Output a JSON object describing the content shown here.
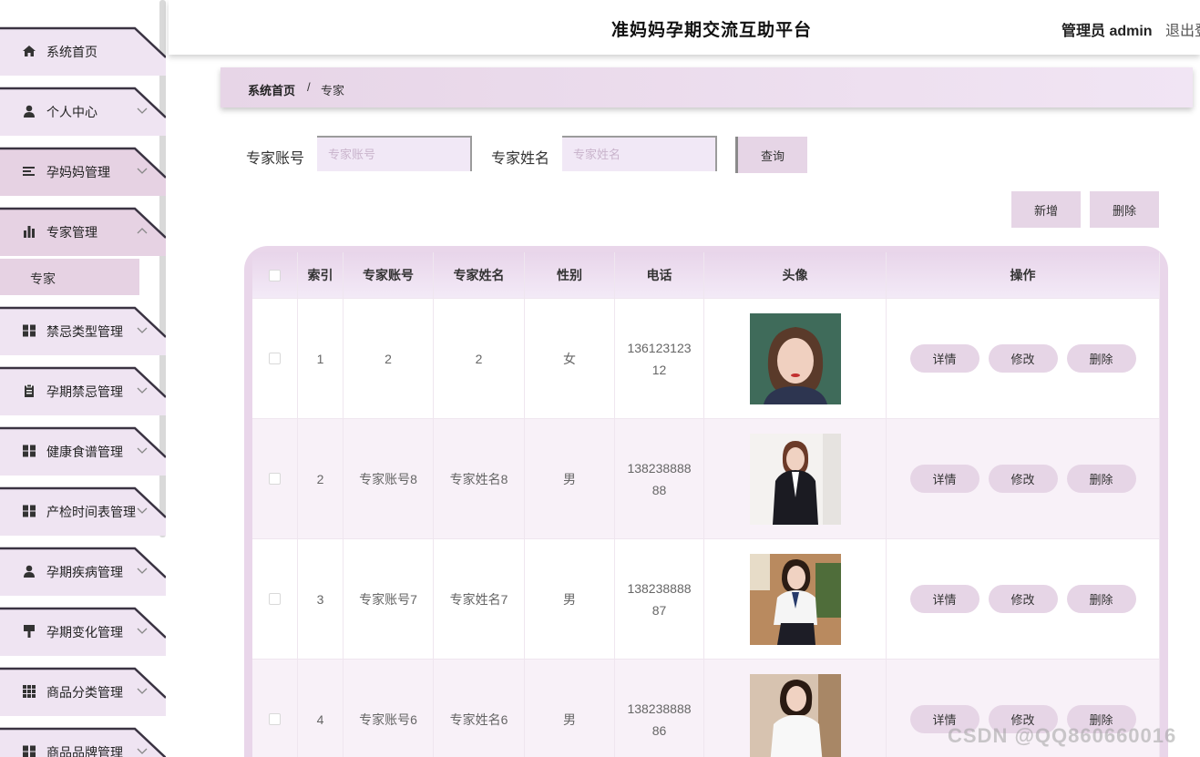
{
  "header": {
    "title": "准妈妈孕期交流互助平台",
    "admin": "管理员 admin",
    "logout": "退出登"
  },
  "sidebar": {
    "items": [
      {
        "label": "系统首页",
        "icon": "home-icon",
        "has_chevron": false
      },
      {
        "label": "个人中心",
        "icon": "user-icon",
        "has_chevron": true
      },
      {
        "label": "孕妈妈管理",
        "icon": "list-icon",
        "has_chevron": true
      },
      {
        "label": "专家管理",
        "icon": "bar-chart-icon",
        "has_chevron": true,
        "expanded": true
      },
      {
        "label": "禁忌类型管理",
        "icon": "grid-icon",
        "has_chevron": true
      },
      {
        "label": "孕期禁忌管理",
        "icon": "clipboard-icon",
        "has_chevron": true
      },
      {
        "label": "健康食谱管理",
        "icon": "grid-icon",
        "has_chevron": true
      },
      {
        "label": "产检时间表管理",
        "icon": "grid-icon",
        "has_chevron": true
      },
      {
        "label": "孕期疾病管理",
        "icon": "user-icon",
        "has_chevron": true
      },
      {
        "label": "孕期变化管理",
        "icon": "brush-icon",
        "has_chevron": true
      },
      {
        "label": "商品分类管理",
        "icon": "apps-icon",
        "has_chevron": true
      },
      {
        "label": "商品品牌管理",
        "icon": "grid-icon",
        "has_chevron": true
      }
    ],
    "submenu": {
      "label": "专家"
    }
  },
  "breadcrumb": {
    "home": "系统首页",
    "separator": "/",
    "current": "专家"
  },
  "search": {
    "account_label": "专家账号",
    "account_placeholder": "专家账号",
    "name_label": "专家姓名",
    "name_placeholder": "专家姓名",
    "query_button": "查询"
  },
  "actions": {
    "add": "新增",
    "delete": "删除"
  },
  "table": {
    "columns": [
      "索引",
      "专家账号",
      "专家姓名",
      "性别",
      "电话",
      "头像",
      "操作"
    ],
    "rows": [
      {
        "index": "1",
        "account": "2",
        "name": "2",
        "gender": "女",
        "phone": "13612312312"
      },
      {
        "index": "2",
        "account": "专家账号8",
        "name": "专家姓名8",
        "gender": "男",
        "phone": "13823888888"
      },
      {
        "index": "3",
        "account": "专家账号7",
        "name": "专家姓名7",
        "gender": "男",
        "phone": "13823888887"
      },
      {
        "index": "4",
        "account": "专家账号6",
        "name": "专家姓名6",
        "gender": "男",
        "phone": "13823888886"
      }
    ],
    "row_actions": {
      "detail": "详情",
      "edit": "修改",
      "delete": "删除"
    }
  },
  "watermark": "CSDN @QQ860660016",
  "colors": {
    "accent": "#e6d5e6",
    "sidebar_tab": "#efe4f2",
    "sidebar_active": "#e6d2e3",
    "table_frame": "#e9d6ea"
  }
}
